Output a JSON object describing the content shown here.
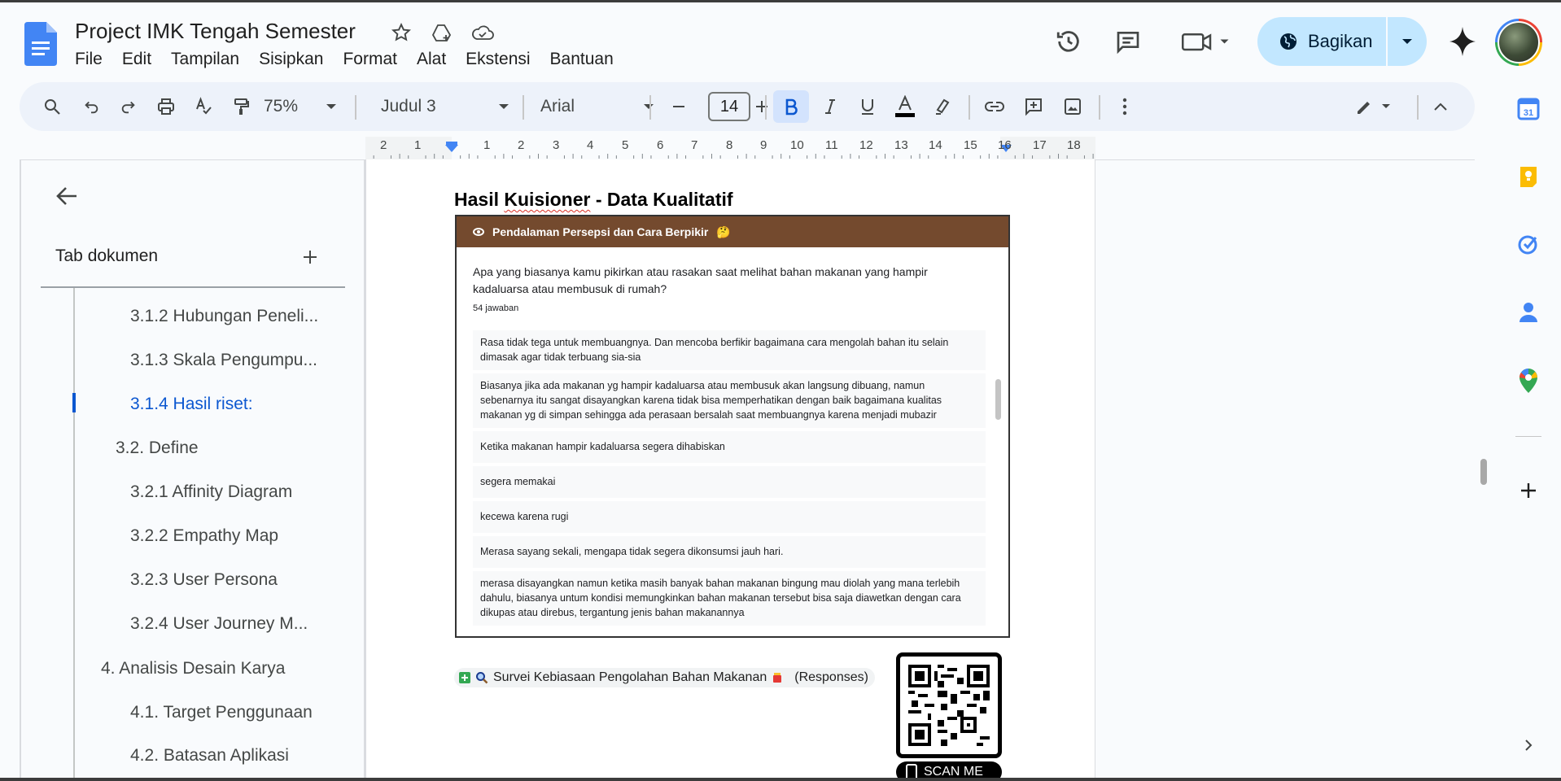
{
  "app": {
    "doc_title": "Project IMK Tengah Semester",
    "menu": [
      "File",
      "Edit",
      "Tampilan",
      "Sisipkan",
      "Format",
      "Alat",
      "Ekstensi",
      "Bantuan"
    ],
    "share_label": "Bagikan",
    "brand_color": "#4285f4",
    "share_bg": "#c2e7ff"
  },
  "toolbar": {
    "zoom": "75%",
    "style": "Judul 3",
    "font": "Arial",
    "font_size": "14"
  },
  "ruler": {
    "labels": [
      "2",
      "1",
      "1",
      "2",
      "3",
      "4",
      "5",
      "6",
      "7",
      "8",
      "9",
      "10",
      "11",
      "12",
      "13",
      "14",
      "15",
      "16",
      "17",
      "18"
    ]
  },
  "sidebar": {
    "tab_label": "Tab dokumen",
    "items": [
      {
        "label": "3.1.2 Hubungan Peneli..."
      },
      {
        "label": "3.1.3 Skala Pengumpu..."
      },
      {
        "label": "3.1.4 Hasil riset:"
      },
      {
        "label": "3.2. Define"
      },
      {
        "label": "3.2.1 Affinity Diagram"
      },
      {
        "label": "3.2.2 Empathy Map"
      },
      {
        "label": "3.2.3 User Persona"
      },
      {
        "label": "3.2.4 User Journey M..."
      },
      {
        "label": "4. Analisis Desain Karya"
      },
      {
        "label": "4.1. Target Penggunaan"
      },
      {
        "label": "4.2. Batasan Aplikasi"
      }
    ]
  },
  "document": {
    "heading_a": "Hasil ",
    "heading_b": "Kuisioner",
    "heading_c": " - Data Kualitatif",
    "embed": {
      "section_title": "Pendalaman Persepsi dan Cara Berpikir",
      "section_emoji": "🤔",
      "question": "Apa yang biasanya kamu pikirkan atau rasakan saat melihat bahan makanan yang hampir kadaluarsa atau membusuk di rumah?",
      "count": "54 jawaban",
      "answers": [
        "Rasa tidak tega untuk membuangnya. Dan mencoba berfikir bagaimana cara mengolah bahan itu selain dimasak agar tidak terbuang sia-sia",
        "Biasanya jika ada makanan yg hampir kadaluarsa atau membusuk akan langsung dibuang, namun sebenarnya itu sangat disayangkan karena tidak bisa memperhatikan dengan baik bagaimana kualitas makanan yg di simpan sehingga ada perasaan bersalah saat membuangnya karena menjadi mubazir",
        "Ketika makanan hampir kadaluarsa segera dihabiskan",
        "segera memakai",
        "kecewa karena rugi",
        "Merasa sayang sekali, mengapa tidak segera dikonsumsi jauh hari.",
        "merasa disayangkan namun ketika masih banyak bahan makanan bingung mau diolah yang mana terlebih dahulu, biasanya untum kondisi memungkinkan bahan makanan tersebut bisa saja diawetkan dengan cara dikupas atau direbus, tergantung jenis bahan makanannya"
      ]
    },
    "chip_label": "Survei Kebiasaan Pengolahan Bahan Makanan",
    "chip_suffix": "(Responses)",
    "scan_label": "SCAN ME"
  }
}
